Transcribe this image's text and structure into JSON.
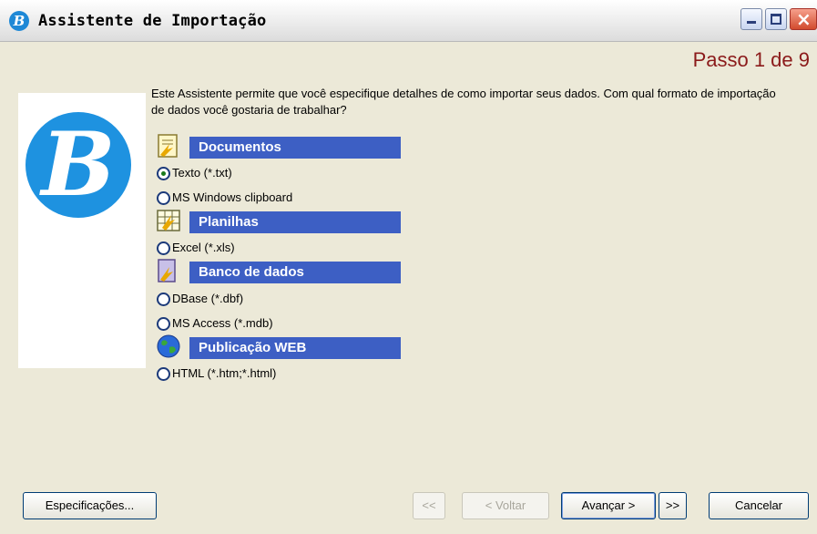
{
  "window": {
    "title": "Assistente de Importação",
    "app_icon_letter": "B"
  },
  "step": "Passo 1 de 9",
  "intro_text": "Este Assistente permite que você especifique detalhes de como importar seus dados. Com qual formato de importação de dados você gostaria de trabalhar?",
  "categories": [
    {
      "label": "Documentos",
      "icon": "document-icon",
      "options": [
        {
          "label": "Texto (*.txt)",
          "selected": true
        },
        {
          "label": "MS Windows clipboard",
          "selected": false
        }
      ]
    },
    {
      "label": "Planilhas",
      "icon": "spreadsheet-icon",
      "options": [
        {
          "label": "Excel (*.xls)",
          "selected": false
        }
      ]
    },
    {
      "label": "Banco de dados",
      "icon": "database-icon",
      "options": [
        {
          "label": "DBase (*.dbf)",
          "selected": false
        },
        {
          "label": "MS Access (*.mdb)",
          "selected": false
        }
      ]
    },
    {
      "label": "Publicação WEB",
      "icon": "globe-icon",
      "options": [
        {
          "label": "HTML (*.htm;*.html)",
          "selected": false
        }
      ]
    }
  ],
  "buttons": {
    "specs": "Especificações...",
    "first": "<<",
    "back": "< Voltar",
    "next": "Avançar >",
    "last": ">>",
    "cancel": "Cancelar"
  },
  "colors": {
    "category_header": "#3d5fc4",
    "step_text": "#8b1a1a",
    "logo": "#1e92e0"
  }
}
